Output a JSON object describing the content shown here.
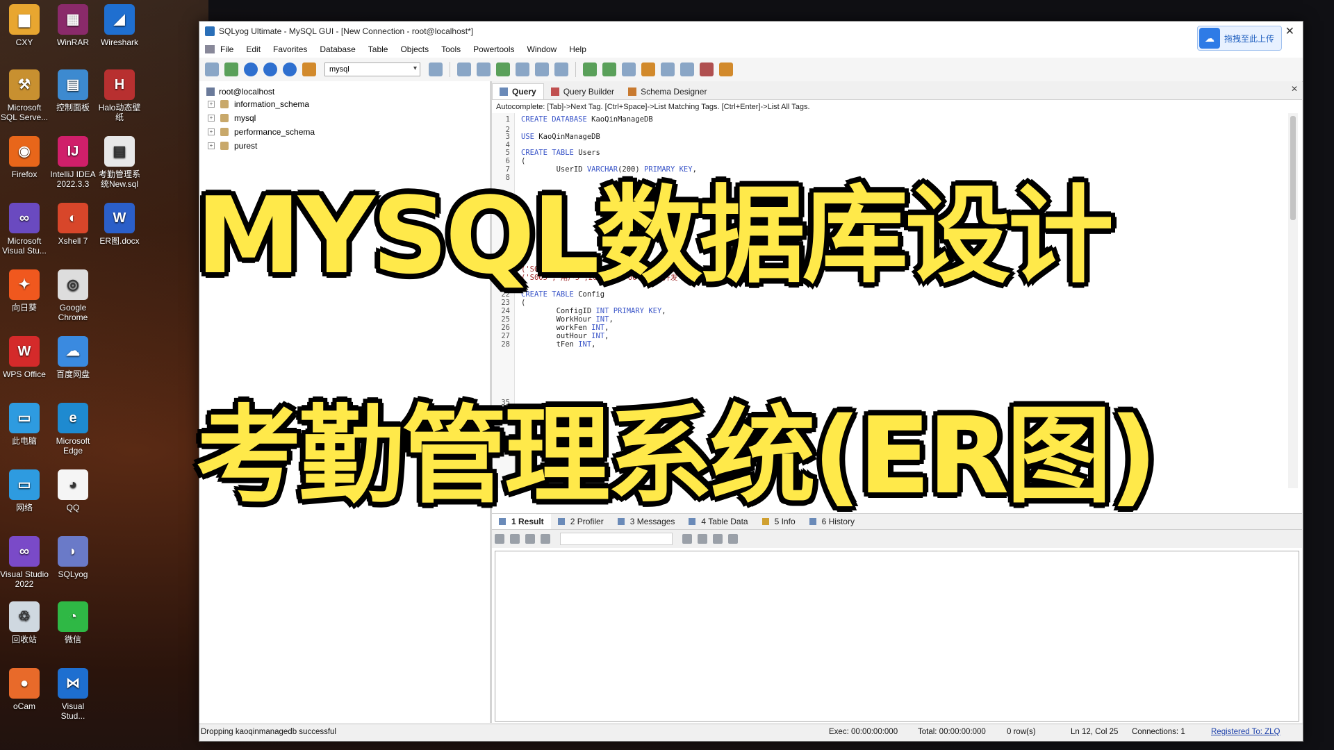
{
  "desktop": {
    "icons": [
      {
        "label": "CXY",
        "color": "#e8a630",
        "glyph": "▆",
        "icon": "folder-icon"
      },
      {
        "label": "WinRAR",
        "color": "#8a2a6a",
        "glyph": "▦",
        "icon": "winrar-icon"
      },
      {
        "label": "Wireshark",
        "color": "#1f6fd0",
        "glyph": "◢",
        "icon": "wireshark-icon"
      },
      {
        "label": "Microsoft SQL Serve...",
        "color": "#c89030",
        "glyph": "⚒",
        "icon": "sql-server-icon"
      },
      {
        "label": "控制面板",
        "color": "#3d8ad0",
        "glyph": "▤",
        "icon": "control-panel-icon"
      },
      {
        "label": "Halo动态壁纸",
        "color": "#b83030",
        "glyph": "H",
        "icon": "halo-icon"
      },
      {
        "label": "Firefox",
        "color": "#e8661a",
        "glyph": "◉",
        "icon": "firefox-icon"
      },
      {
        "label": "IntelliJ IDEA 2022.3.3",
        "color": "#d01f6a",
        "glyph": "IJ",
        "icon": "intellij-icon"
      },
      {
        "label": "考勤管理系统New.sql",
        "color": "#e8e8e8",
        "glyph": "▤",
        "icon": "sql-file-icon"
      },
      {
        "label": "Microsoft Visual Stu...",
        "color": "#6a4ac0",
        "glyph": "∞",
        "icon": "visual-studio-icon"
      },
      {
        "label": "Xshell 7",
        "color": "#d8462a",
        "glyph": "◐",
        "icon": "xshell-icon"
      },
      {
        "label": "ER图.docx",
        "color": "#2b5fc9",
        "glyph": "W",
        "icon": "word-icon"
      },
      {
        "label": "向日葵",
        "color": "#f0581e",
        "glyph": "✦",
        "icon": "sunflower-icon"
      },
      {
        "label": "Google Chrome",
        "color": "#ddd",
        "glyph": "◎",
        "icon": "chrome-icon"
      },
      {
        "label": "WPS Office",
        "color": "#d42a2a",
        "glyph": "W",
        "icon": "wps-icon"
      },
      {
        "label": "百度网盘",
        "color": "#3a8ae0",
        "glyph": "☁",
        "icon": "baidu-netdisk-icon"
      },
      {
        "label": "此电脑",
        "color": "#2e9be0",
        "glyph": "▭",
        "icon": "this-pc-icon"
      },
      {
        "label": "Microsoft Edge",
        "color": "#1e8ad0",
        "glyph": "e",
        "icon": "edge-icon"
      },
      {
        "label": "网络",
        "color": "#2e9be0",
        "glyph": "▭",
        "icon": "network-icon"
      },
      {
        "label": "QQ",
        "color": "#f5f5f5",
        "glyph": "◕",
        "icon": "qq-icon"
      },
      {
        "label": "Visual Studio 2022",
        "color": "#7a4ac8",
        "glyph": "∞",
        "icon": "vs2022-icon"
      },
      {
        "label": "SQLyog",
        "color": "#6a7ac8",
        "glyph": "◗",
        "icon": "sqlyog-icon"
      },
      {
        "label": "回收站",
        "color": "#cfd8e0",
        "glyph": "♲",
        "icon": "recycle-bin-icon"
      },
      {
        "label": "微信",
        "color": "#2fb845",
        "glyph": "◔",
        "icon": "wechat-icon"
      },
      {
        "label": "oCam",
        "color": "#e86a2a",
        "glyph": "●",
        "icon": "ocam-icon"
      },
      {
        "label": "Visual Stud...",
        "color": "#1e6fd0",
        "glyph": "⋈",
        "icon": "vscode-icon"
      }
    ]
  },
  "window": {
    "title": "SQLyog Ultimate - MySQL GUI - [New Connection - root@localhost*]",
    "upload_label": "拖拽至此上传"
  },
  "menu": [
    "File",
    "Edit",
    "Favorites",
    "Database",
    "Table",
    "Objects",
    "Tools",
    "Powertools",
    "Window",
    "Help"
  ],
  "toolbar": {
    "db_select": "mysql"
  },
  "object_browser": {
    "root": "root@localhost",
    "databases": [
      "information_schema",
      "mysql",
      "performance_schema",
      "purest"
    ]
  },
  "query_tabs": [
    "Query",
    "Query Builder",
    "Schema Designer"
  ],
  "autocomplete_hint": "Autocomplete: [Tab]->Next Tag. [Ctrl+Space]->List Matching Tags. [Ctrl+Enter]->List All Tags.",
  "editor_lines": [
    {
      "n": "1",
      "code": [
        [
          "kw",
          "CREATE DATABASE "
        ],
        [
          "id",
          "KaoQinManageDB"
        ]
      ]
    },
    {
      "n": "2",
      "code": []
    },
    {
      "n": "3",
      "code": [
        [
          "kw",
          "USE "
        ],
        [
          "id",
          "KaoQinManageDB"
        ]
      ]
    },
    {
      "n": "4",
      "code": []
    },
    {
      "n": "5",
      "code": [
        [
          "kw",
          "CREATE TABLE "
        ],
        [
          "id",
          "Users"
        ]
      ]
    },
    {
      "n": "6",
      "code": [
        [
          "id",
          "("
        ]
      ]
    },
    {
      "n": "7",
      "code": [
        [
          "id",
          "        UserID "
        ],
        [
          "kw",
          "VARCHAR"
        ],
        [
          "id",
          "(200) "
        ],
        [
          "kw",
          "PRIMARY KEY"
        ],
        [
          "id",
          ","
        ]
      ]
    },
    {
      "n": "8",
      "code": []
    },
    {
      "n": "19",
      "code": [
        [
          "str",
          "('S004','用户4',20,'2024-06-20','开发','男','123'),"
        ]
      ]
    },
    {
      "n": "20",
      "code": [
        [
          "str",
          "('S005','用户5',20,'2024-06-20','开发','男','123')"
        ]
      ]
    },
    {
      "n": "21",
      "code": []
    },
    {
      "n": "22",
      "code": [
        [
          "kw",
          "CREATE TABLE "
        ],
        [
          "id",
          "Config"
        ]
      ]
    },
    {
      "n": "23",
      "code": [
        [
          "id",
          "("
        ]
      ]
    },
    {
      "n": "24",
      "code": [
        [
          "id",
          "        ConfigID "
        ],
        [
          "kw",
          "INT PRIMARY KEY"
        ],
        [
          "id",
          ","
        ]
      ]
    },
    {
      "n": "25",
      "code": [
        [
          "id",
          "        WorkHour "
        ],
        [
          "kw",
          "INT"
        ],
        [
          "id",
          ","
        ]
      ]
    },
    {
      "n": "26",
      "code": [
        [
          "id",
          "        workFen "
        ],
        [
          "kw",
          "INT"
        ],
        [
          "id",
          ","
        ]
      ]
    },
    {
      "n": "27",
      "code": [
        [
          "id",
          "        outHour "
        ],
        [
          "kw",
          "INT"
        ],
        [
          "id",
          ","
        ]
      ]
    },
    {
      "n": "28",
      "code": [
        [
          "id",
          "        tFen "
        ],
        [
          "kw",
          "INT"
        ],
        [
          "id",
          ","
        ]
      ]
    },
    {
      "n": "35",
      "code": []
    }
  ],
  "result_tabs": [
    "1 Result",
    "2 Profiler",
    "3 Messages",
    "4 Table Data",
    "5 Info",
    "6 History"
  ],
  "status": {
    "message": "Dropping kaoqinmanagedb successful",
    "exec": "Exec: 00:00:00:000",
    "total": "Total: 00:00:00:000",
    "rows": "0 row(s)",
    "position": "Ln 12, Col 25",
    "connections": "Connections: 1",
    "registered": "Registered To: ZLQ"
  },
  "overlay": {
    "line1": "MYSQL数据库设计",
    "line2": "考勤管理系统(ER图)",
    "color": "#ffe94a"
  }
}
